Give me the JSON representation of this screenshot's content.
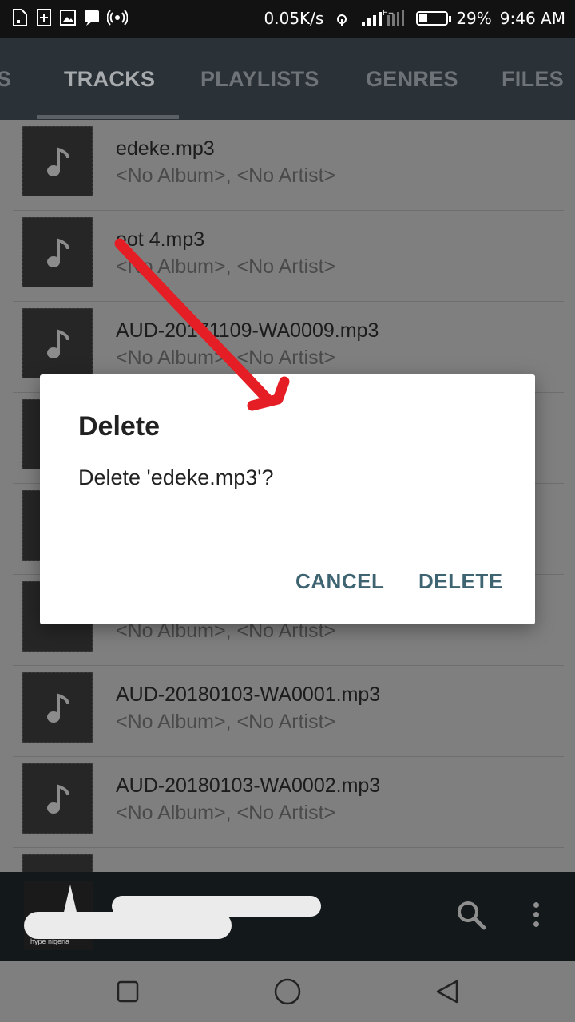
{
  "status_bar": {
    "network_speed": "0.05K/s",
    "network_type": "H+",
    "battery": "29%",
    "time": "9:46 AM",
    "battery_level": 0.29
  },
  "tabs": {
    "items": [
      {
        "label": "S",
        "active": false
      },
      {
        "label": "TRACKS",
        "active": true
      },
      {
        "label": "PLAYLISTS",
        "active": false
      },
      {
        "label": "GENRES",
        "active": false
      },
      {
        "label": "FILES",
        "active": false
      }
    ]
  },
  "tracks": [
    {
      "title": "edeke.mp3",
      "subtitle": "<No Album>, <No Artist>"
    },
    {
      "title": "eot 4.mp3",
      "subtitle": "<No Album>, <No Artist>"
    },
    {
      "title": "AUD-20171109-WA0009.mp3",
      "subtitle": "<No Album>, <No Artist>"
    },
    {
      "title": "",
      "subtitle": ""
    },
    {
      "title": "",
      "subtitle": ""
    },
    {
      "title": "",
      "subtitle": "<No Album>, <No Artist>"
    },
    {
      "title": "AUD-20180103-WA0001.mp3",
      "subtitle": "<No Album>, <No Artist>"
    },
    {
      "title": "AUD-20180103-WA0002.mp3",
      "subtitle": "<No Album>, <No Artist>"
    },
    {
      "title": "",
      "subtitle": ""
    }
  ],
  "player": {
    "album_brand": "hype nigeria",
    "search_icon": "search-icon",
    "more_icon": "more-vert-icon"
  },
  "dialog": {
    "title": "Delete",
    "message": "Delete 'edeke.mp3'?",
    "cancel_label": "CANCEL",
    "delete_label": "DELETE"
  },
  "colors": {
    "dialog_button": "#3f6471",
    "annotation_arrow": "#e51d24",
    "tab_bar": "#2b3237"
  }
}
